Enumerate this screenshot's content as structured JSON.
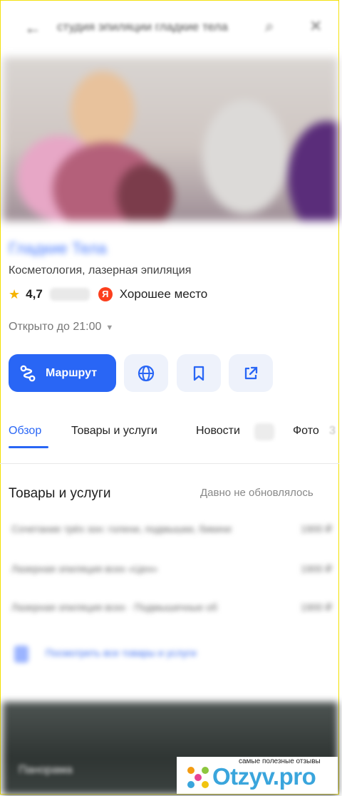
{
  "topbar": {
    "title": "студия эпиляции гладкие тела"
  },
  "place": {
    "name": "Гладкие Тела",
    "category": "Косметология, лазерная эпиляция",
    "rating": "4,7",
    "badge_letter": "Я",
    "badge_text": "Хорошее место",
    "hours": "Открыто до 21:00"
  },
  "actions": {
    "route_label": "Маршрут"
  },
  "tabs": [
    {
      "label": "Обзор"
    },
    {
      "label": "Товары и услуги"
    },
    {
      "label": "Новости"
    },
    {
      "label": "Фото"
    },
    {
      "label": "3"
    }
  ],
  "goods": {
    "title": "Товары и услуги",
    "note": "Давно не обновлялось",
    "items": [
      {
        "name": "Сочетание трёх зон: голени, подмышки, бикини",
        "price": "1900 ₽"
      },
      {
        "name": "Лазерная эпиляция всех «Цен»",
        "price": "1900 ₽"
      },
      {
        "name": "Лазерная эпиляция всех · Подмышечные об",
        "price": "1900 ₽"
      }
    ],
    "more_label": "Посмотреть все товары и услуги"
  },
  "photo_block": {
    "label": "Панорама"
  },
  "watermark": {
    "tagline": "самые полезные отзывы",
    "brand": "Otzyv.pro"
  }
}
